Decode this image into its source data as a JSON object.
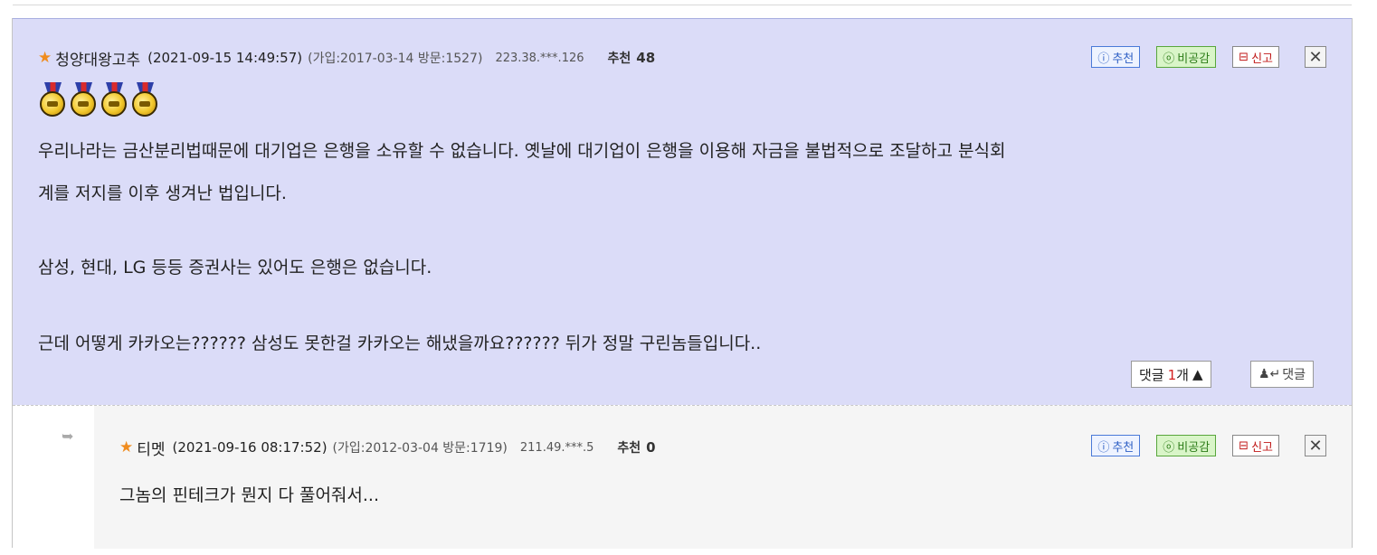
{
  "main_comment": {
    "nickname": "청양대왕고추",
    "datetime": "(2021-09-15 14:49:57)",
    "registration": "(가입:2017-03-14 방문:1527)",
    "ip": "223.38.***.126",
    "recommend_label": "추천",
    "recommend_count": "48",
    "lines": [
      "우리나라는 금산분리법때문에 대기업은 은행을 소유할 수 없습니다. 옛날에 대기업이 은행을 이용해 자금을 불법적으로 조달하고 분식회",
      "계를 저지를 이후 생겨난 법입니다.",
      "삼성, 현대, LG 등등 증권사는 있어도 은행은 없습니다.",
      "근데 어떻게 카카오는?????? 삼성도 못한걸 카카오는 해냈을까요?????? 뒤가 정말 구린놈들입니다.."
    ],
    "reply_count_prefix": "댓글",
    "reply_count_value": "1",
    "reply_count_suffix": "개",
    "reply_button_label": "댓글"
  },
  "reply_comment": {
    "nickname": "티멧",
    "datetime": "(2021-09-16 08:17:52)",
    "registration": "(가입:2012-03-04 방문:1719)",
    "ip": "211.49.***.5",
    "recommend_label": "추천",
    "recommend_count": "0",
    "text": "그놈의 핀테크가 뭔지 다 풀어줘서..."
  },
  "buttons": {
    "recommend": "추천",
    "disagree": "비공감",
    "report": "신고"
  },
  "colors": {
    "main_bg": "#dbdcf8",
    "star": "#f08c1e",
    "reply_count_number": "#d42020"
  }
}
